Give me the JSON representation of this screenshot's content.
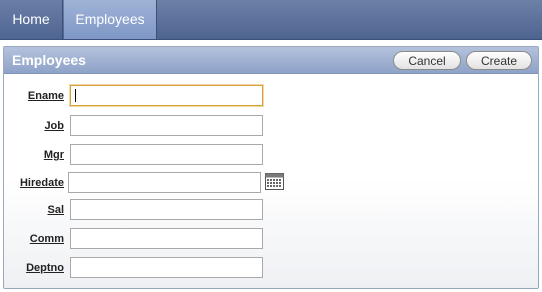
{
  "nav": {
    "tabs": [
      {
        "label": "Home"
      },
      {
        "label": "Employees"
      }
    ]
  },
  "region": {
    "title": "Employees",
    "cancel_label": "Cancel",
    "create_label": "Create"
  },
  "form": {
    "fields": [
      {
        "label": "Ename",
        "value": ""
      },
      {
        "label": "Job",
        "value": ""
      },
      {
        "label": "Mgr",
        "value": ""
      },
      {
        "label": "Hiredate",
        "value": ""
      },
      {
        "label": "Sal",
        "value": ""
      },
      {
        "label": "Comm",
        "value": ""
      },
      {
        "label": "Deptno",
        "value": ""
      }
    ],
    "date_picker_icon": "calendar-icon"
  },
  "colors": {
    "nav_bg": "#5a6f9b",
    "active_tab": "#8ea4cf",
    "region_header": "#9fb0d2",
    "focus_border": "#d8a23a"
  }
}
